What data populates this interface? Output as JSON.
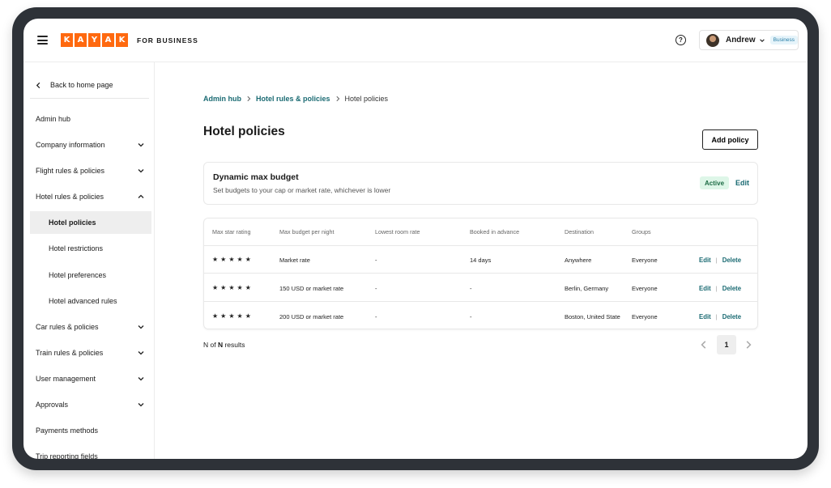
{
  "header": {
    "logo_letters": [
      "K",
      "A",
      "Y",
      "A",
      "K"
    ],
    "logo_subtitle": "FOR BUSINESS",
    "help_glyph": "?",
    "user_name": "Andrew",
    "user_badge": "Business",
    "brand_color": "#ff690f"
  },
  "icons": {
    "menu": "hamburger-icon",
    "help": "help-icon",
    "back": "chevron-left-icon",
    "expand": "chevron-down-icon",
    "collapse": "chevron-up-icon"
  },
  "sidebar": {
    "back_label": "Back to home page",
    "items": [
      {
        "label": "Admin hub",
        "chevron": "none",
        "sub": false,
        "active": false
      },
      {
        "label": "Company information",
        "chevron": "down",
        "sub": false,
        "active": false
      },
      {
        "label": "Flight rules & policies",
        "chevron": "down",
        "sub": false,
        "active": false
      },
      {
        "label": "Hotel rules & policies",
        "chevron": "up",
        "sub": false,
        "active": false
      },
      {
        "label": "Hotel policies",
        "chevron": "none",
        "sub": true,
        "active": true
      },
      {
        "label": "Hotel restrictions",
        "chevron": "none",
        "sub": true,
        "active": false
      },
      {
        "label": "Hotel preferences",
        "chevron": "none",
        "sub": true,
        "active": false
      },
      {
        "label": "Hotel advanced rules",
        "chevron": "none",
        "sub": true,
        "active": false
      },
      {
        "label": "Car rules & policies",
        "chevron": "down",
        "sub": false,
        "active": false
      },
      {
        "label": "Train rules & policies",
        "chevron": "down",
        "sub": false,
        "active": false
      },
      {
        "label": "User management",
        "chevron": "down",
        "sub": false,
        "active": false
      },
      {
        "label": "Approvals",
        "chevron": "down",
        "sub": false,
        "active": false
      },
      {
        "label": "Payments methods",
        "chevron": "none",
        "sub": false,
        "active": false
      },
      {
        "label": "Trip reporting fields",
        "chevron": "none",
        "sub": false,
        "active": false
      }
    ]
  },
  "breadcrumb": {
    "items": [
      "Admin hub",
      "Hotel rules & policies"
    ],
    "current": "Hotel policies"
  },
  "main": {
    "title": "Hotel policies",
    "add_button": "Add policy"
  },
  "budget_card": {
    "title": "Dynamic max budget",
    "description": "Set budgets to your cap or market rate, whichever is lower",
    "status": "Active",
    "edit_label": "Edit"
  },
  "table": {
    "columns": [
      "Max star rating",
      "Max budget per night",
      "Lowest room rate",
      "Booked in advance",
      "Destination",
      "Groups"
    ],
    "rows": [
      {
        "stars": "★★★★★",
        "budget": "Market rate",
        "lowest": "-",
        "advance": "14 days",
        "destination": "Anywhere",
        "groups": "Everyone"
      },
      {
        "stars": "★★★★★",
        "budget": "150 USD or market rate",
        "lowest": "-",
        "advance": "-",
        "destination": "Berlin, Germany",
        "groups": "Everyone"
      },
      {
        "stars": "★★★★★",
        "budget": "200 USD or market rate",
        "lowest": "-",
        "advance": "-",
        "destination": "Boston, United State",
        "groups": "Everyone"
      }
    ],
    "edit_label": "Edit",
    "delete_label": "Delete",
    "separator": "|"
  },
  "pagination": {
    "results_prefix": "N of ",
    "results_n": "N",
    "results_suffix": " results",
    "current_page": "1"
  }
}
